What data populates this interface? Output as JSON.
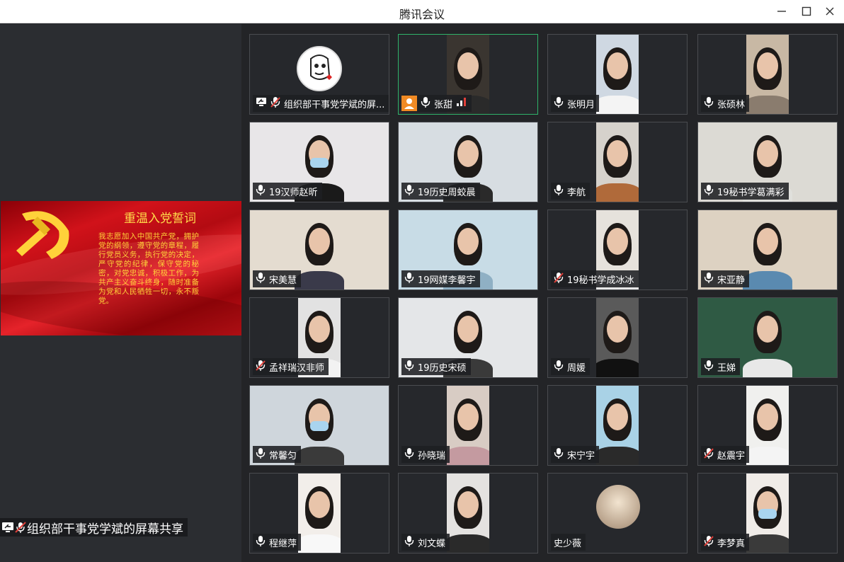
{
  "window": {
    "title": "腾讯会议"
  },
  "share": {
    "slide_title": "重温入党誓词",
    "slide_text": "我志愿加入中国共产党，拥护党的纲领，遵守党的章程，履行党员义务，执行党的决定，严守党的纪律，保守党的秘密，对党忠诚，积极工作，为共产主义奋斗终身，随时准备为党和人民牺牲一切，永不叛党。",
    "label": "组织部干事党学斌的屏幕共享"
  },
  "participants": [
    {
      "name": "组织部干事党学斌的屏...",
      "mic": "muted",
      "sharing": true,
      "avatar": "logo"
    },
    {
      "name": "张甜",
      "mic": "on",
      "host": true,
      "signal": true,
      "active": true,
      "video": "narrow",
      "bg": "#3a3530",
      "shirt": "#2a2a2a"
    },
    {
      "name": "张明月",
      "mic": "on",
      "video": "narrow",
      "bg": "#cfd8e2",
      "shirt": "#f4f4f4"
    },
    {
      "name": "张硕林",
      "mic": "on",
      "video": "narrow",
      "bg": "#c8b8a4",
      "shirt": "#8a7c6e"
    },
    {
      "name": "19汉师赵昕",
      "mic": "on",
      "video": "full",
      "bg": "#e8e6e8",
      "shirt": "#1a1a1a",
      "mask": true
    },
    {
      "name": "19历史周蛟晨",
      "mic": "on",
      "video": "full",
      "bg": "#d7dde2",
      "shirt": "#2a2a2a"
    },
    {
      "name": "李航",
      "mic": "on",
      "video": "narrow",
      "bg": "#d6d2cc",
      "shirt": "#b06a3a"
    },
    {
      "name": "19秘书学葛满彩",
      "mic": "on",
      "video": "full",
      "bg": "#dcdad4",
      "shirt": "#e0e0dc"
    },
    {
      "name": "宋美慧",
      "mic": "on",
      "video": "full",
      "bg": "#e4dcd0",
      "shirt": "#3a3a4a"
    },
    {
      "name": "19网媒李馨宇",
      "mic": "on",
      "video": "full",
      "bg": "#c8dce6",
      "shirt": "#8fb0c4"
    },
    {
      "name": "19秘书学成冰冰",
      "mic": "muted",
      "video": "narrow",
      "bg": "#e6e2dc",
      "shirt": "#e8e8e8"
    },
    {
      "name": "宋亚静",
      "mic": "on",
      "video": "full",
      "bg": "#ddd2c2",
      "shirt": "#5a8ab0"
    },
    {
      "name": "孟祥瑞汉非师",
      "mic": "muted",
      "video": "narrow",
      "bg": "#e2e2e2",
      "shirt": "#f2f2f2"
    },
    {
      "name": "19历史宋硕",
      "mic": "on",
      "video": "full",
      "bg": "#e4e6e8",
      "shirt": "#3a3a3a"
    },
    {
      "name": "周媛",
      "mic": "on",
      "video": "narrow",
      "bg": "#5a5a5a",
      "shirt": "#111111"
    },
    {
      "name": "王娣",
      "mic": "on",
      "video": "full",
      "bg": "#2f5a44",
      "shirt": "#e8e8e8"
    },
    {
      "name": "常馨匀",
      "mic": "on",
      "video": "full",
      "bg": "#cfd6dc",
      "shirt": "#3a3a3a",
      "mask": true
    },
    {
      "name": "孙晓瑞",
      "mic": "on",
      "video": "narrow",
      "bg": "#d8ccc4",
      "shirt": "#c49aa0"
    },
    {
      "name": "宋宁宇",
      "mic": "on",
      "video": "narrow",
      "bg": "#a9d2e6",
      "shirt": "#2a2a2a"
    },
    {
      "name": "赵震宇",
      "mic": "muted",
      "video": "narrow",
      "bg": "#f0f0ee",
      "shirt": "#f4f4f4"
    },
    {
      "name": "程继萍",
      "mic": "on",
      "video": "narrow",
      "bg": "#f2eeea",
      "shirt": "#f8f8f8"
    },
    {
      "name": "刘文蝶",
      "mic": "on",
      "video": "narrow",
      "bg": "#e4e2e0",
      "shirt": "#2a2a2a"
    },
    {
      "name": "史少薇",
      "mic": "none",
      "avatar": "photo"
    },
    {
      "name": "李梦真",
      "mic": "muted",
      "video": "narrow",
      "bg": "#f0ece8",
      "shirt": "#3a3a3a",
      "mask": true
    }
  ]
}
